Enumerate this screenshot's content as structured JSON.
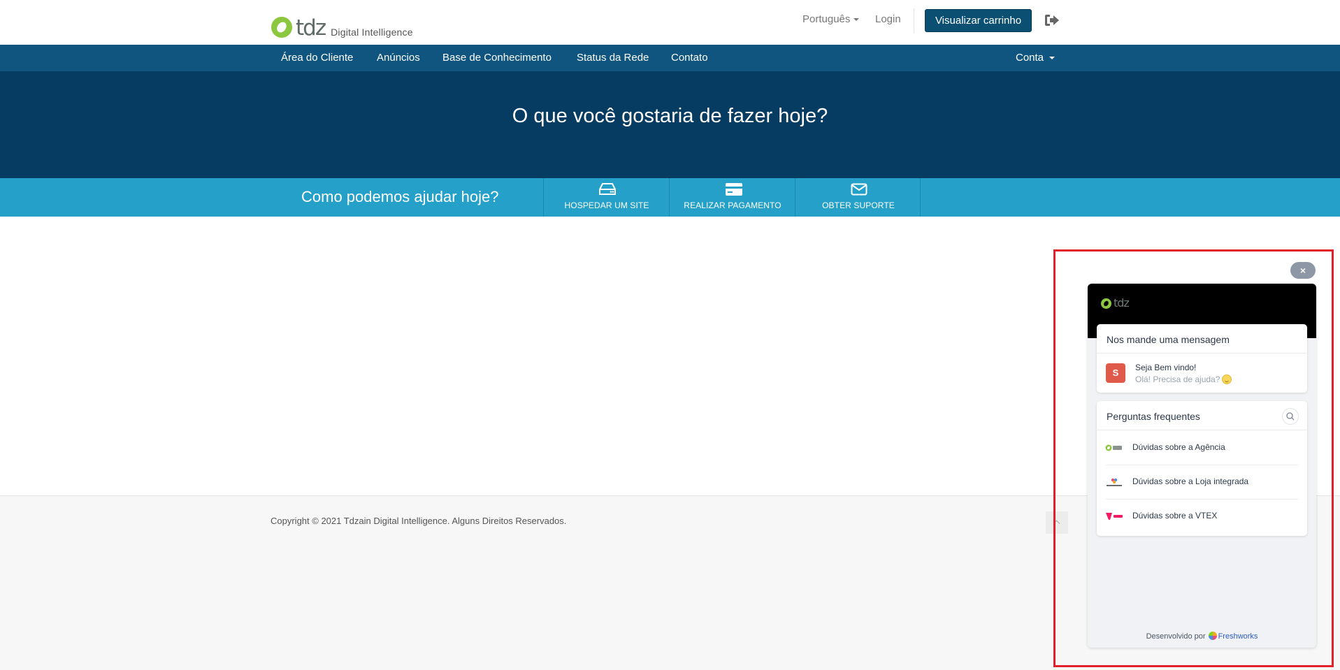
{
  "header": {
    "logo_text": "tdz",
    "logo_subtitle": "Digital Intelligence",
    "language": "Português",
    "login": "Login",
    "cart_button": "Visualizar carrinho"
  },
  "nav": {
    "items": [
      "Área do Cliente",
      "Anúncios",
      "Base de Conhecimento",
      "Status da Rede",
      "Contato"
    ],
    "account": "Conta"
  },
  "hero": {
    "title": "O que você gostaria de fazer hoje?"
  },
  "helpbar": {
    "text": "Como podemos ajudar hoje?",
    "buttons": [
      {
        "label": "HOSPEDAR UM SITE",
        "icon": "server-icon"
      },
      {
        "label": "REALIZAR PAGAMENTO",
        "icon": "credit-card-icon"
      },
      {
        "label": "OBTER SUPORTE",
        "icon": "envelope-icon"
      }
    ]
  },
  "footer": {
    "copyright": "Copyright © 2021 Tdzain Digital Intelligence. Alguns Direitos Reservados."
  },
  "chat_widget": {
    "close": "×",
    "logo_text": "tdz",
    "message_card": {
      "title": "Nos mande uma mensagem",
      "avatar_letter": "S",
      "greeting": "Seja Bem vindo!",
      "subtext": "Olá! Precisa de ajuda?"
    },
    "faq": {
      "title": "Perguntas frequentes",
      "items": [
        {
          "label": "Dúvidas sobre a Agência"
        },
        {
          "label": "Dúvidas sobre a Loja integrada"
        },
        {
          "label": "Dúvidas sobre a VTEX"
        }
      ]
    },
    "powered_by": "Desenvolvido por",
    "powered_brand": "Freshworks"
  },
  "colors": {
    "nav_bg": "#0f5580",
    "hero_bg": "#063c61",
    "helpbar_bg": "#25a1c9",
    "cart_button_bg": "#0b4f72",
    "logo_green": "#8dc63f",
    "highlight_red": "#e0202a"
  }
}
